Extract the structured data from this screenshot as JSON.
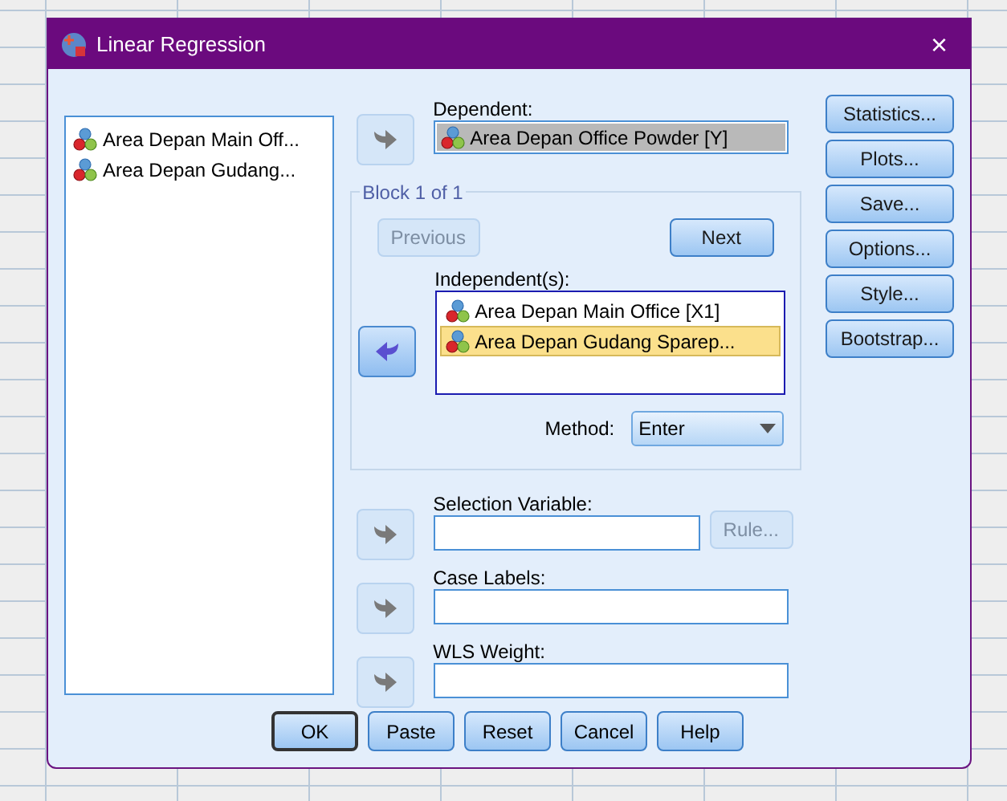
{
  "window": {
    "title": "Linear Regression",
    "close": "×"
  },
  "variables": [
    {
      "label": "Area Depan Main Off...",
      "selected": false
    },
    {
      "label": "Area Depan Gudang...",
      "selected": false
    }
  ],
  "dependent": {
    "label": "Dependent:",
    "arrow": {
      "kind": "add",
      "disabled": true
    },
    "items": [
      {
        "label": "Area Depan Office Powder [Y]",
        "selected": true
      }
    ]
  },
  "block": {
    "title": "Block 1 of 1",
    "previous": {
      "label": "Previous",
      "disabled": true
    },
    "next": {
      "label": "Next",
      "disabled": false
    },
    "independent_label": "Independent(s):",
    "arrow": {
      "kind": "remove",
      "disabled": false
    },
    "items": [
      {
        "label": "Area Depan Main Office [X1]",
        "selected": false
      },
      {
        "label": "Area Depan Gudang Sparep...",
        "selected": true
      }
    ],
    "method_label": "Method:",
    "method_value": "Enter"
  },
  "fields": [
    {
      "label": "Selection Variable:",
      "arrow": {
        "kind": "add",
        "disabled": true
      },
      "rule": {
        "label": "Rule...",
        "disabled": true
      }
    },
    {
      "label": "Case Labels:",
      "arrow": {
        "kind": "add",
        "disabled": true
      }
    },
    {
      "label": "WLS Weight:",
      "arrow": {
        "kind": "add",
        "disabled": true
      }
    }
  ],
  "side_buttons": [
    "Statistics...",
    "Plots...",
    "Save...",
    "Options...",
    "Style...",
    "Bootstrap..."
  ],
  "bottom_buttons": [
    {
      "label": "OK",
      "default": true
    },
    {
      "label": "Paste",
      "default": false
    },
    {
      "label": "Reset",
      "default": false
    },
    {
      "label": "Cancel",
      "default": false
    },
    {
      "label": "Help",
      "default": false
    }
  ]
}
